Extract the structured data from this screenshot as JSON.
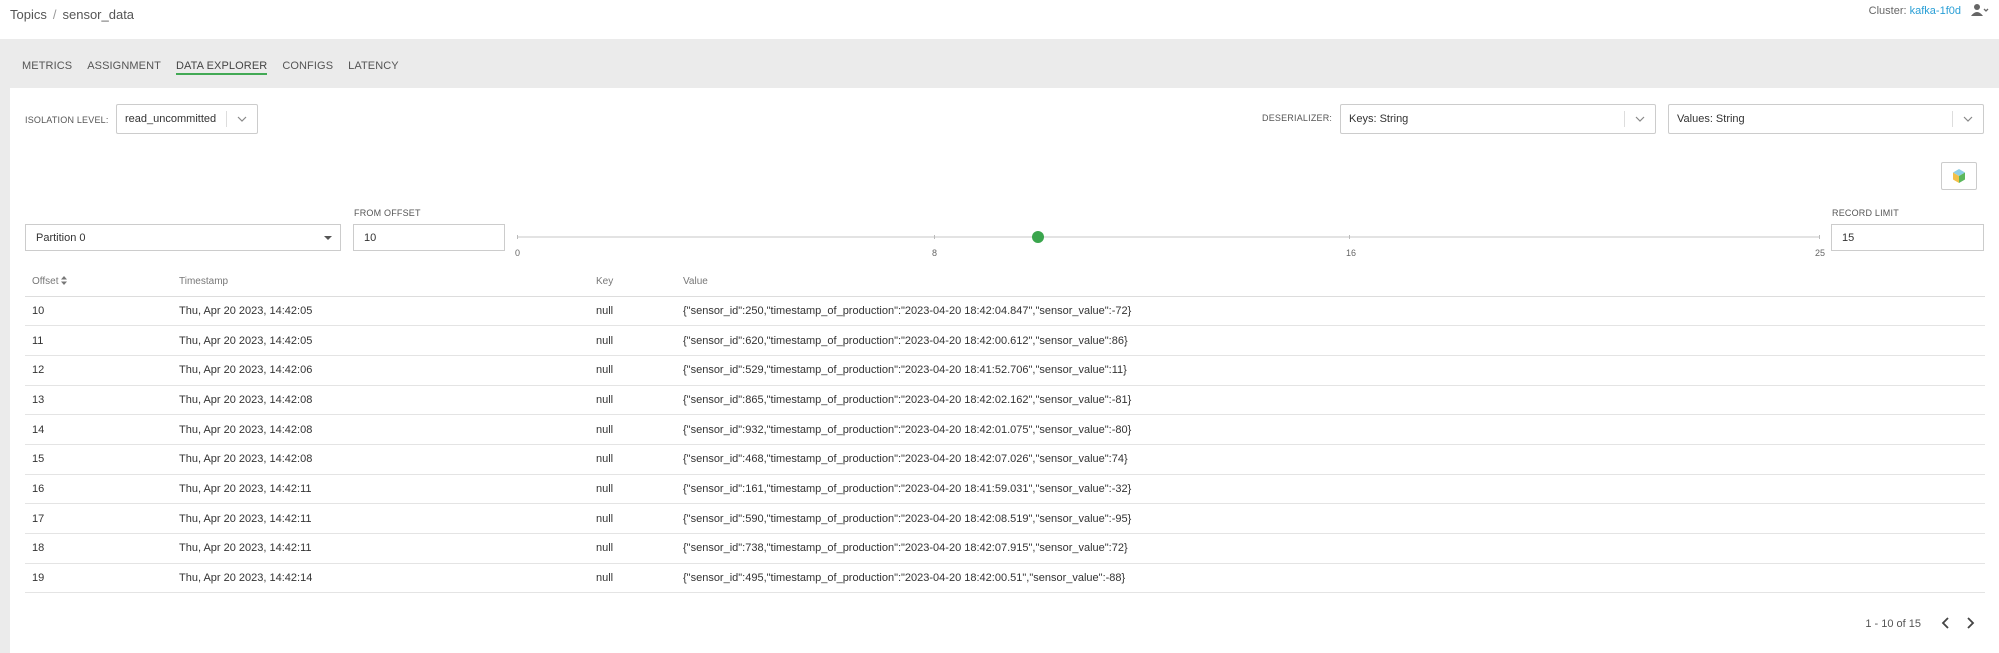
{
  "breadcrumb": {
    "root": "Topics",
    "separator": "/",
    "current": "sensor_data"
  },
  "cluster": {
    "label": "Cluster:",
    "name": "kafka-1f0d"
  },
  "tabs": [
    {
      "label": "METRICS"
    },
    {
      "label": "ASSIGNMENT"
    },
    {
      "label": "DATA EXPLORER",
      "active": true
    },
    {
      "label": "CONFIGS"
    },
    {
      "label": "LATENCY"
    }
  ],
  "isolation": {
    "label": "ISOLATION LEVEL:",
    "value": "read_uncommitted"
  },
  "deserializer": {
    "label": "DESERIALIZER:",
    "keys": "Keys: String",
    "values": "Values: String"
  },
  "partition": {
    "value": "Partition 0"
  },
  "from_offset": {
    "label": "FROM OFFSET",
    "value": "10"
  },
  "slider": {
    "ticks": [
      "0",
      "8",
      "16",
      "25"
    ],
    "min": 0,
    "max": 25,
    "value": 10
  },
  "record_limit": {
    "label": "RECORD LIMIT",
    "value": "15"
  },
  "table": {
    "headers": {
      "offset": "Offset",
      "timestamp": "Timestamp",
      "key": "Key",
      "value": "Value"
    },
    "rows": [
      {
        "offset": "10",
        "timestamp": "Thu, Apr 20 2023, 14:42:05",
        "key": "null",
        "value": "{\"sensor_id\":250,\"timestamp_of_production\":\"2023-04-20 18:42:04.847\",\"sensor_value\":-72}"
      },
      {
        "offset": "11",
        "timestamp": "Thu, Apr 20 2023, 14:42:05",
        "key": "null",
        "value": "{\"sensor_id\":620,\"timestamp_of_production\":\"2023-04-20 18:42:00.612\",\"sensor_value\":86}"
      },
      {
        "offset": "12",
        "timestamp": "Thu, Apr 20 2023, 14:42:06",
        "key": "null",
        "value": "{\"sensor_id\":529,\"timestamp_of_production\":\"2023-04-20 18:41:52.706\",\"sensor_value\":11}"
      },
      {
        "offset": "13",
        "timestamp": "Thu, Apr 20 2023, 14:42:08",
        "key": "null",
        "value": "{\"sensor_id\":865,\"timestamp_of_production\":\"2023-04-20 18:42:02.162\",\"sensor_value\":-81}"
      },
      {
        "offset": "14",
        "timestamp": "Thu, Apr 20 2023, 14:42:08",
        "key": "null",
        "value": "{\"sensor_id\":932,\"timestamp_of_production\":\"2023-04-20 18:42:01.075\",\"sensor_value\":-80}"
      },
      {
        "offset": "15",
        "timestamp": "Thu, Apr 20 2023, 14:42:08",
        "key": "null",
        "value": "{\"sensor_id\":468,\"timestamp_of_production\":\"2023-04-20 18:42:07.026\",\"sensor_value\":74}"
      },
      {
        "offset": "16",
        "timestamp": "Thu, Apr 20 2023, 14:42:11",
        "key": "null",
        "value": "{\"sensor_id\":161,\"timestamp_of_production\":\"2023-04-20 18:41:59.031\",\"sensor_value\":-32}"
      },
      {
        "offset": "17",
        "timestamp": "Thu, Apr 20 2023, 14:42:11",
        "key": "null",
        "value": "{\"sensor_id\":590,\"timestamp_of_production\":\"2023-04-20 18:42:08.519\",\"sensor_value\":-95}"
      },
      {
        "offset": "18",
        "timestamp": "Thu, Apr 20 2023, 14:42:11",
        "key": "null",
        "value": "{\"sensor_id\":738,\"timestamp_of_production\":\"2023-04-20 18:42:07.915\",\"sensor_value\":72}"
      },
      {
        "offset": "19",
        "timestamp": "Thu, Apr 20 2023, 14:42:14",
        "key": "null",
        "value": "{\"sensor_id\":495,\"timestamp_of_production\":\"2023-04-20 18:42:00.51\",\"sensor_value\":-88}"
      }
    ]
  },
  "pagination": {
    "text": "1 - 10 of 15"
  },
  "colors": {
    "accent": "#3aa54d",
    "link": "#2a9fd6"
  },
  "icons": [
    "sort-icon",
    "user-icon",
    "chevron-down-icon",
    "caret-down-icon",
    "cube-icon",
    "chevron-left-icon",
    "chevron-right-icon"
  ]
}
